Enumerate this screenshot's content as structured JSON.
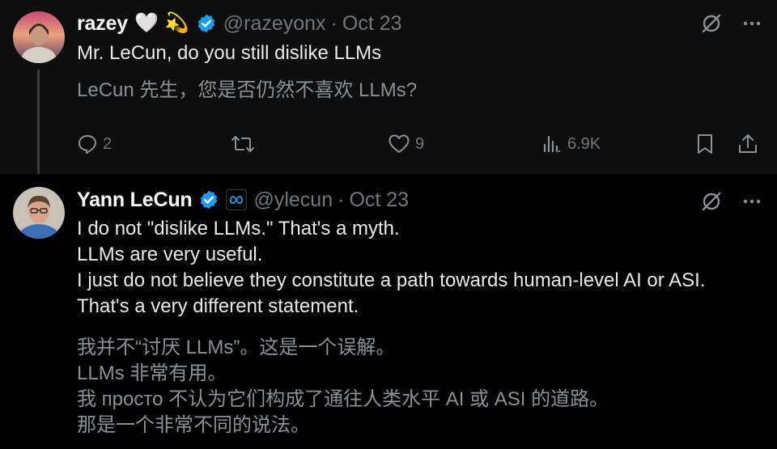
{
  "tweet1": {
    "name": "razey",
    "emoji_heart": "🤍",
    "emoji_star": "💫",
    "handle": "@razeyonx",
    "dot": "·",
    "date": "Oct 23",
    "text_en": "Mr. LeCun, do you still dislike LLMs",
    "text_zh": "LeCun 先生，您是否仍然不喜欢 LLMs?",
    "replies": "2",
    "likes": "9",
    "views": "6.9K"
  },
  "tweet2": {
    "name": "Yann LeCun",
    "handle": "@ylecun",
    "dot": "·",
    "date": "Oct 23",
    "text_en": "I do not \"dislike LLMs.\" That's a myth.\nLLMs are very useful.\nI just do not believe they constitute a path towards human-level AI or ASI.\nThat's a very different statement.",
    "text_zh": "我并不“讨厌 LLMs”。这是一个误解。\nLLMs 非常有用。\n我 просто 不认为它们构成了通往人类水平 AI 或 ASI 的道路。\n那是一个非常不同的说法。"
  },
  "icons": {
    "verified": "verified-badge-icon",
    "affiliation": "meta-affiliation-icon",
    "grok": "grok-icon",
    "more": "more-icon",
    "reply": "reply-icon",
    "retweet": "retweet-icon",
    "like": "like-icon",
    "views": "views-icon",
    "bookmark": "bookmark-icon",
    "share": "share-icon"
  },
  "colors": {
    "verified_blue": "#1d9bf0",
    "text_secondary": "#71767b",
    "background": "#000000"
  }
}
